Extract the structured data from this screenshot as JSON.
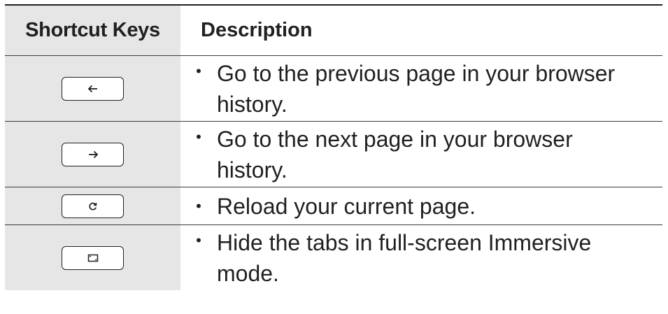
{
  "table": {
    "headers": {
      "keys": "Shortcut Keys",
      "description": "Description"
    },
    "bullet": "•",
    "rows": [
      {
        "key_icon": "back-arrow-icon",
        "description": "Go to the previous page in your browser history."
      },
      {
        "key_icon": "forward-arrow-icon",
        "description": "Go to the next page in your browser history."
      },
      {
        "key_icon": "reload-icon",
        "description": "Reload your current page."
      },
      {
        "key_icon": "full-screen-icon",
        "description": "Hide the tabs in full-screen Immersive mode."
      }
    ]
  }
}
